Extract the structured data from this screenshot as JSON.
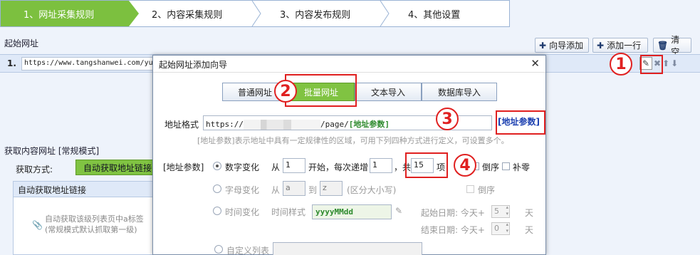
{
  "steps": [
    {
      "label": "1、网址采集规则",
      "active": true
    },
    {
      "label": "2、内容采集规则",
      "active": false
    },
    {
      "label": "3、内容发布规则",
      "active": false
    },
    {
      "label": "4、其他设置",
      "active": false
    }
  ],
  "start_urls": {
    "title": "起始网址",
    "toolbar": {
      "wizard_add": "向导添加",
      "add_row": "添加一行",
      "clear": "清空"
    },
    "rows": [
      {
        "index": "1.",
        "url": "https://www.tangshanwei.com/yu"
      }
    ]
  },
  "content_urls": {
    "title": "获取内容网址 [常规模式]",
    "mode_label": "获取方式:",
    "mode_button": "自动获取地址链接",
    "panel_header": "自动获取地址链接",
    "note_line1": "自动获取该级列表页中a标签",
    "note_line2": "(常规模式默认抓取第一级)"
  },
  "modal": {
    "title": "起始网址添加向导",
    "tabs": [
      {
        "label": "普通网址",
        "active": false
      },
      {
        "label": "批量网址",
        "active": true
      },
      {
        "label": "文本导入",
        "active": false
      },
      {
        "label": "数据库导入",
        "active": false
      }
    ],
    "format_label": "地址格式",
    "format_prefix": "https://",
    "format_suffix": "/page/",
    "format_param": "[地址参数]",
    "param_link": "[地址参数]",
    "hint": "[地址参数]表示地址中具有一定规律性的区域，可用下列四种方式进行定义，可设置多个。",
    "params_label": "[地址参数]",
    "numeric": {
      "label": "数字变化",
      "from_label": "从",
      "from_value": "1",
      "start_label": "开始，每次递增",
      "step_value": "1",
      "total_label": "，共",
      "count_value": "15",
      "items_label": "项",
      "reverse_label": "倒序",
      "pad_label": "补零"
    },
    "letter": {
      "label": "字母变化",
      "from_label": "从",
      "from_value": "a",
      "to_label": "到",
      "to_value": "z",
      "case_label": "(区分大小写)",
      "reverse_label": "倒序"
    },
    "time": {
      "label": "时间变化",
      "style_label": "时间样式",
      "style_value": "yyyyMMdd",
      "start_label": "起始日期: 今天+",
      "start_value": "5",
      "end_label": "结束日期: 今天+",
      "end_value": "0",
      "day_unit": "天"
    },
    "custom": {
      "label": "自定义列表"
    }
  },
  "callouts": [
    "1",
    "2",
    "3",
    "4"
  ],
  "colors": {
    "accent_green": "#80c342",
    "callout_red": "#e02020",
    "link_blue": "#1b3fb0"
  }
}
